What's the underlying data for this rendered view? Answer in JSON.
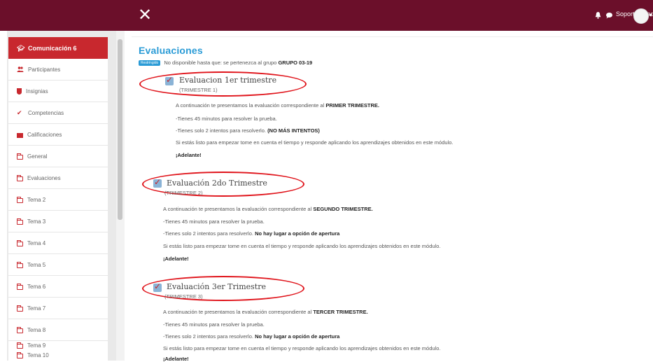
{
  "header": {
    "user_name": "Soporte Psad",
    "close_glyph": "✕",
    "colors": {
      "bar": "#6b0f2a"
    }
  },
  "sidebar": {
    "items": [
      {
        "label": "Comunicación 6",
        "icon": "graduation-cap-icon"
      },
      {
        "label": "Participantes",
        "icon": "users-icon"
      },
      {
        "label": "Insignias",
        "icon": "shield-icon"
      },
      {
        "label": "Competencias",
        "icon": "check-icon"
      },
      {
        "label": "Calificaciones",
        "icon": "table-icon"
      },
      {
        "label": "General",
        "icon": "folder-icon"
      },
      {
        "label": "Evaluaciones",
        "icon": "folder-icon"
      },
      {
        "label": "Tema 2",
        "icon": "folder-icon"
      },
      {
        "label": "Tema 3",
        "icon": "folder-icon"
      },
      {
        "label": "Tema 4",
        "icon": "folder-icon"
      },
      {
        "label": "Tema 5",
        "icon": "folder-icon"
      },
      {
        "label": "Tema 6",
        "icon": "folder-icon"
      },
      {
        "label": "Tema 7",
        "icon": "folder-icon"
      },
      {
        "label": "Tema 8",
        "icon": "folder-icon"
      },
      {
        "label": "Tema 9",
        "icon": "folder-icon"
      },
      {
        "label": "Tema 10",
        "icon": "folder-icon"
      }
    ]
  },
  "main": {
    "title": "Evaluaciones",
    "restriction": {
      "badge": "Restringido",
      "text": "No disponible hasta que: se pertenezca al grupo",
      "group": "GRUPO 03-19"
    },
    "activities": [
      {
        "title": "Evaluacion 1er trimestre",
        "subtitle": "(TRIMESTRE 1)",
        "intro": "A continuación te presentamos la evaluación correspondiente al",
        "intro_bold": "PRIMER TRIMESTRE.",
        "time": "-Tienes 45 minutos para resolver la prueba.",
        "attempts": "-Tienes solo 2 intentos para resolverlo.",
        "attempts_bold": "(NO MÁS INTENTOS)",
        "ready": "Si estás listo para empezar tome en cuenta el tiempo y responde aplicando los aprendizajes obtenidos en este módulo.",
        "go": "¡Adelante!"
      },
      {
        "title": "Evaluación 2do Trimestre",
        "subtitle": "(TRIMESTRE 2)",
        "intro": "A continuación te presentamos la evaluación correspondiente al",
        "intro_bold": "SEGUNDO TRIMESTRE.",
        "time": "-Tienes 45 minutos para resolver la prueba.",
        "attempts": "-Tienes solo 2 intentos para resolverlo.",
        "attempts_bold": "No hay lugar a opción de apertura",
        "ready": "Si estás listo para empezar tome en cuenta el tiempo y responde aplicando los aprendizajes obtenidos en este módulo.",
        "go": "¡Adelante!"
      },
      {
        "title": "Evaluación 3er Trimestre",
        "subtitle": "(TRIMESTRE 3)",
        "intro": "A continuación te presentamos la evaluación correspondiente al",
        "intro_bold": "TERCER TRIMESTRE.",
        "time": "-Tienes 45 minutos para resolver la prueba.",
        "attempts": "-Tienes solo 2 intentos para resolverlo.",
        "attempts_bold": "No hay lugar a opción de apertura",
        "ready": "Si estás listo para empezar tome en cuenta el tiempo y responde aplicando los aprendizajes obtenidos en este módulo.",
        "go": "¡Adelante!"
      }
    ]
  }
}
